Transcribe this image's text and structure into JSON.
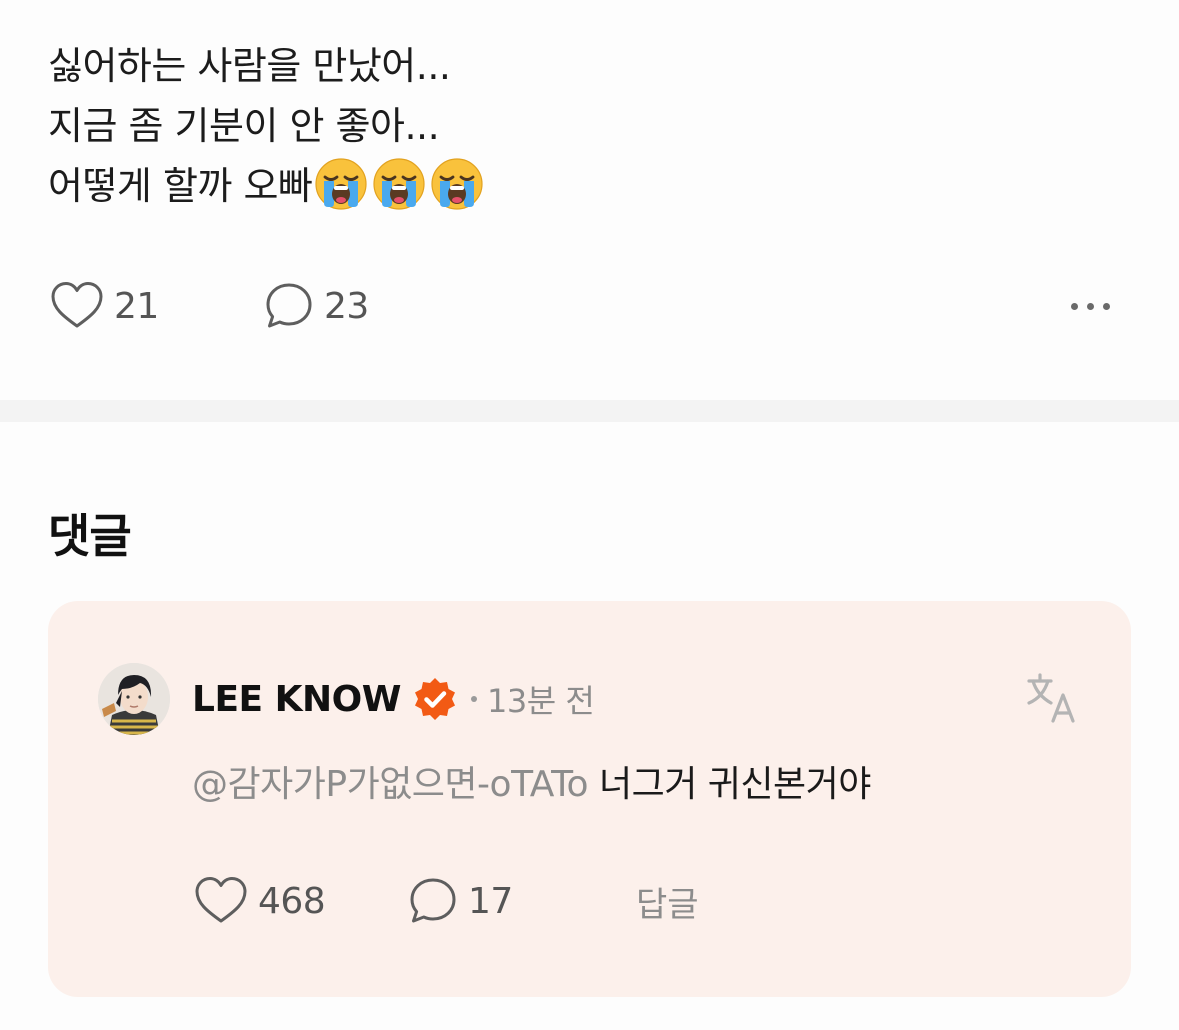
{
  "post": {
    "lines": [
      "싫어하는 사람을 만났어...",
      "지금 좀 기분이 안 좋아...",
      "어떻게 할까 오빠"
    ],
    "emoji": [
      "loudly-crying-face",
      "loudly-crying-face",
      "loudly-crying-face"
    ],
    "like_count": "21",
    "comment_count": "23",
    "more_icon": "more-horizontal-icon"
  },
  "comments_section": {
    "title": "댓글"
  },
  "comment": {
    "author": "LEE KNOW",
    "verified": true,
    "time": "13분 전",
    "mention": "@감자가P가없으면-oTATo",
    "text": "너그거 귀신본거야",
    "like_count": "468",
    "reply_count": "17",
    "reply_label": "답글",
    "translate_icon": "translate-icon"
  },
  "colors": {
    "card_background": "#fcf0eb",
    "verified_badge": "#f25a14",
    "muted_text": "#8c8c8c"
  }
}
